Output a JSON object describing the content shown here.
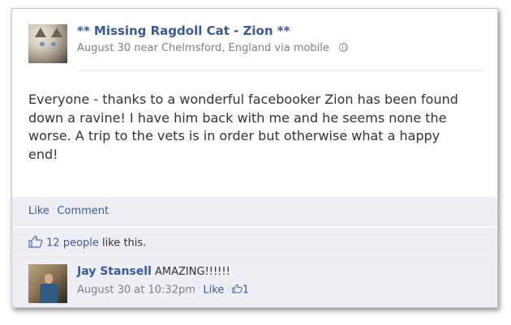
{
  "post": {
    "title": "** Missing Ragdoll Cat - Zion **",
    "meta": "August 30 near Chelmsford, England via mobile",
    "privacy_icon": "globe-icon",
    "message": "Everyone - thanks to a wonderful facebooker Zion has been found down a ravine! I have him back with me and he seems none the worse. A trip to the vets is in order but otherwise what a happy end!"
  },
  "actions": {
    "like_label": "Like",
    "separator": "·",
    "comment_label": "Comment"
  },
  "likes": {
    "icon": "thumbs-up-icon",
    "people_link": "12 people",
    "suffix": " like this."
  },
  "comment": {
    "author": "Jay Stansell",
    "text": "AMAZING!!!!!!",
    "timestamp": "August 30 at 10:32pm",
    "like_label": "Like",
    "like_count": "1"
  },
  "colors": {
    "link_blue": "#3b5998",
    "panel_bg": "#edeff4",
    "meta_gray": "#808080"
  }
}
